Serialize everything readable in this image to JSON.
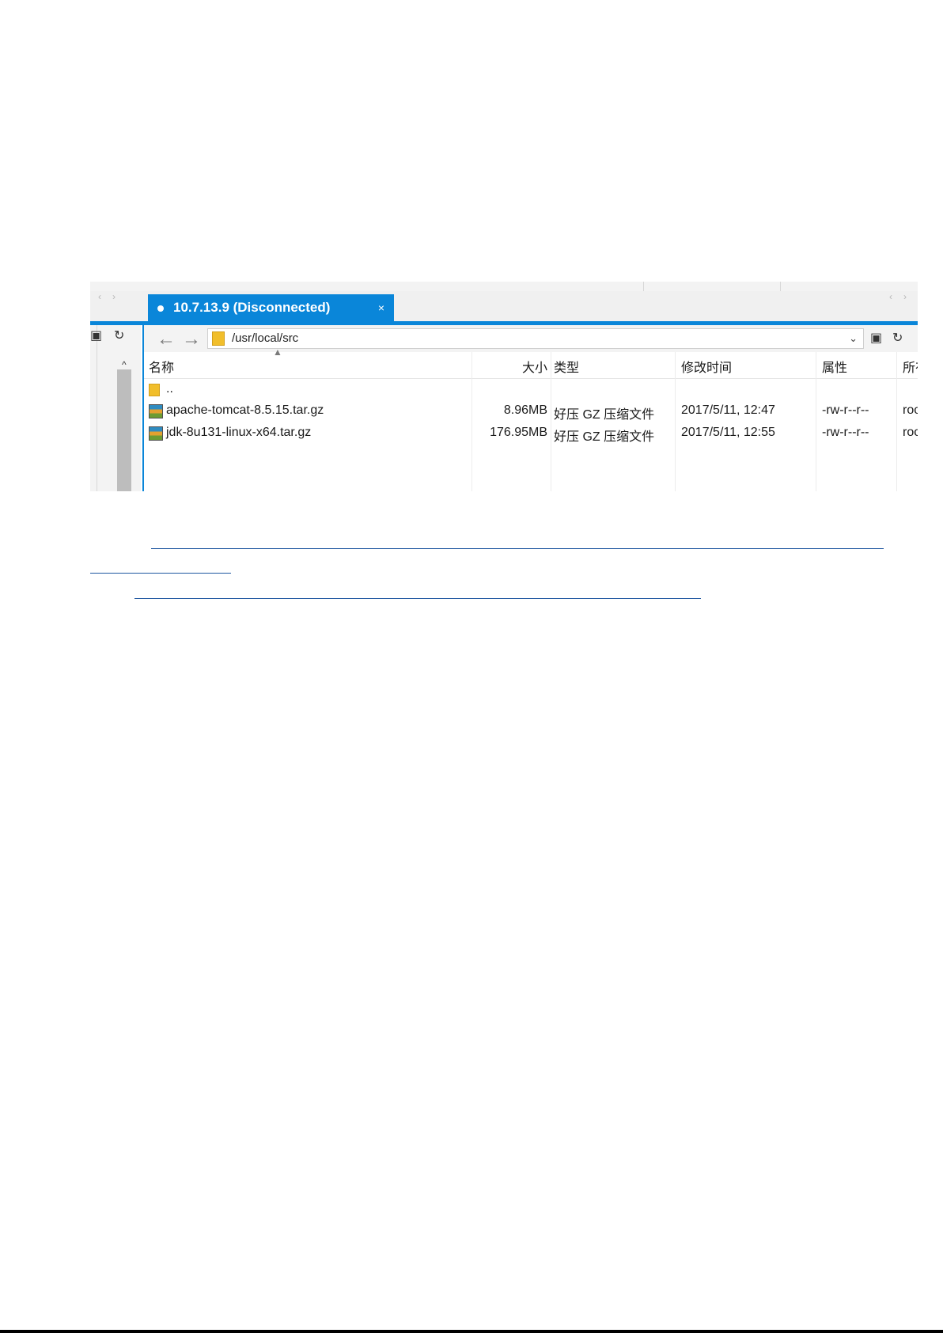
{
  "tab": {
    "title": "10.7.13.9 (Disconnected)",
    "close": "×"
  },
  "path": {
    "value": "/usr/local/src"
  },
  "columns": {
    "name": "名称",
    "size": "大小",
    "type": "类型",
    "modified": "修改时间",
    "attributes": "属性",
    "owner": "所有者"
  },
  "rows": [
    {
      "name": "..",
      "size": "",
      "type": "",
      "modified": "",
      "attributes": "",
      "owner": ""
    },
    {
      "name": "apache-tomcat-8.5.15.tar.gz",
      "size": "8.96MB",
      "type": "好压 GZ 压缩文件",
      "modified": "2017/5/11, 12:47",
      "attributes": "-rw-r--r--",
      "owner": "root"
    },
    {
      "name": "jdk-8u131-linux-x64.tar.gz",
      "size": "176.95MB",
      "type": "好压 GZ 压缩文件",
      "modified": "2017/5/11, 12:55",
      "attributes": "-rw-r--r--",
      "owner": "root"
    }
  ],
  "icons": {
    "nav_left": "chevron-left-icon",
    "nav_right": "chevron-right-icon",
    "back": "arrow-left-icon",
    "forward": "arrow-right-icon",
    "folder": "folder-icon",
    "archive": "archive-icon",
    "refresh": "refresh-icon",
    "dropdown": "chevron-down-icon",
    "sort": "sort-up-icon"
  },
  "colors": {
    "tab_accent": "#0a86d9",
    "link_line": "#1e56a0"
  }
}
